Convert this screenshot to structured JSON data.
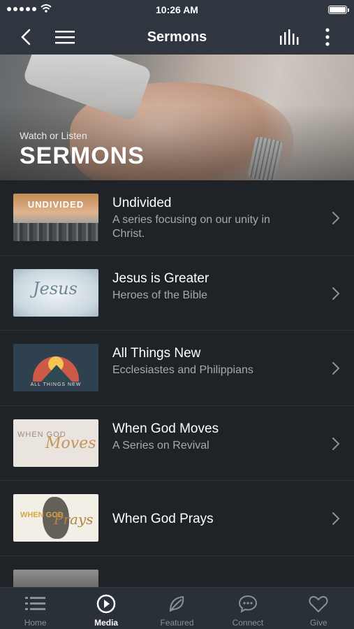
{
  "status_bar": {
    "time": "10:26 AM"
  },
  "nav": {
    "title": "Sermons"
  },
  "hero": {
    "subtitle": "Watch or Listen",
    "title": "SERMONS"
  },
  "sermons": [
    {
      "title": "Undivided",
      "description": "A series focusing on our unity in Christ.",
      "thumb_text": "UNDIVIDED"
    },
    {
      "title": "Jesus is Greater",
      "description": "Heroes of the Bible",
      "thumb_text": "Jesus"
    },
    {
      "title": "All Things New",
      "description": "Ecclesiastes and Philippians",
      "thumb_text": "ALL THINGS NEW"
    },
    {
      "title": "When God Moves",
      "description": "A Series on Revival",
      "thumb_text_1": "WHEN GOD",
      "thumb_text_2": "Moves"
    },
    {
      "title": "When God Prays",
      "description": "",
      "thumb_text_1": "WHEN GOD",
      "thumb_text_2": "Prays"
    }
  ],
  "tabs": [
    {
      "label": "Home",
      "icon": "list-icon"
    },
    {
      "label": "Media",
      "icon": "play-icon",
      "active": true
    },
    {
      "label": "Featured",
      "icon": "leaf-icon"
    },
    {
      "label": "Connect",
      "icon": "chat-icon"
    },
    {
      "label": "Give",
      "icon": "heart-icon"
    }
  ],
  "colors": {
    "background": "#1f2226",
    "bar": "#2f3640",
    "secondary_text": "#a6a9ad"
  }
}
